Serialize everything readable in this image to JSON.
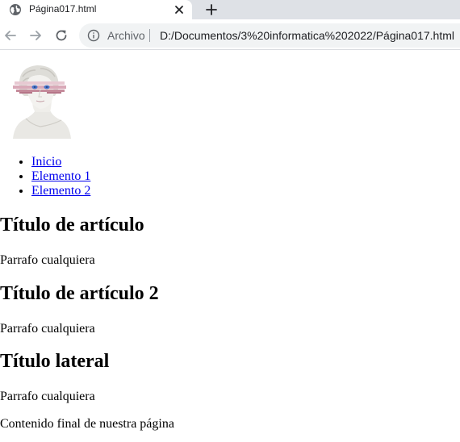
{
  "browser": {
    "tab_title": "Página017.html",
    "omnibox": {
      "scheme_label": "Archivo",
      "url": "D:/Documentos/3%20informatica%202022/Página017.html"
    }
  },
  "page": {
    "nav": [
      {
        "label": "Inicio"
      },
      {
        "label": "Elemento 1"
      },
      {
        "label": "Elemento 2"
      }
    ],
    "article1": {
      "title": "Título de artículo",
      "paragraph": "Parrafo cualquiera"
    },
    "article2": {
      "title": "Título de artículo 2",
      "paragraph": "Parrafo cualquiera"
    },
    "aside": {
      "title": "Título lateral",
      "paragraph": "Parrafo cualquiera"
    },
    "footer": {
      "text": "Contenido final de nuestra página"
    }
  },
  "colors": {
    "link": "#0000ee",
    "tabstrip": "#dee1e6",
    "omnibox_bg": "#f1f3f4"
  },
  "icons": [
    "globe-icon",
    "close-icon",
    "plus-icon",
    "back-arrow-icon",
    "forward-arrow-icon",
    "reload-icon",
    "info-icon"
  ]
}
